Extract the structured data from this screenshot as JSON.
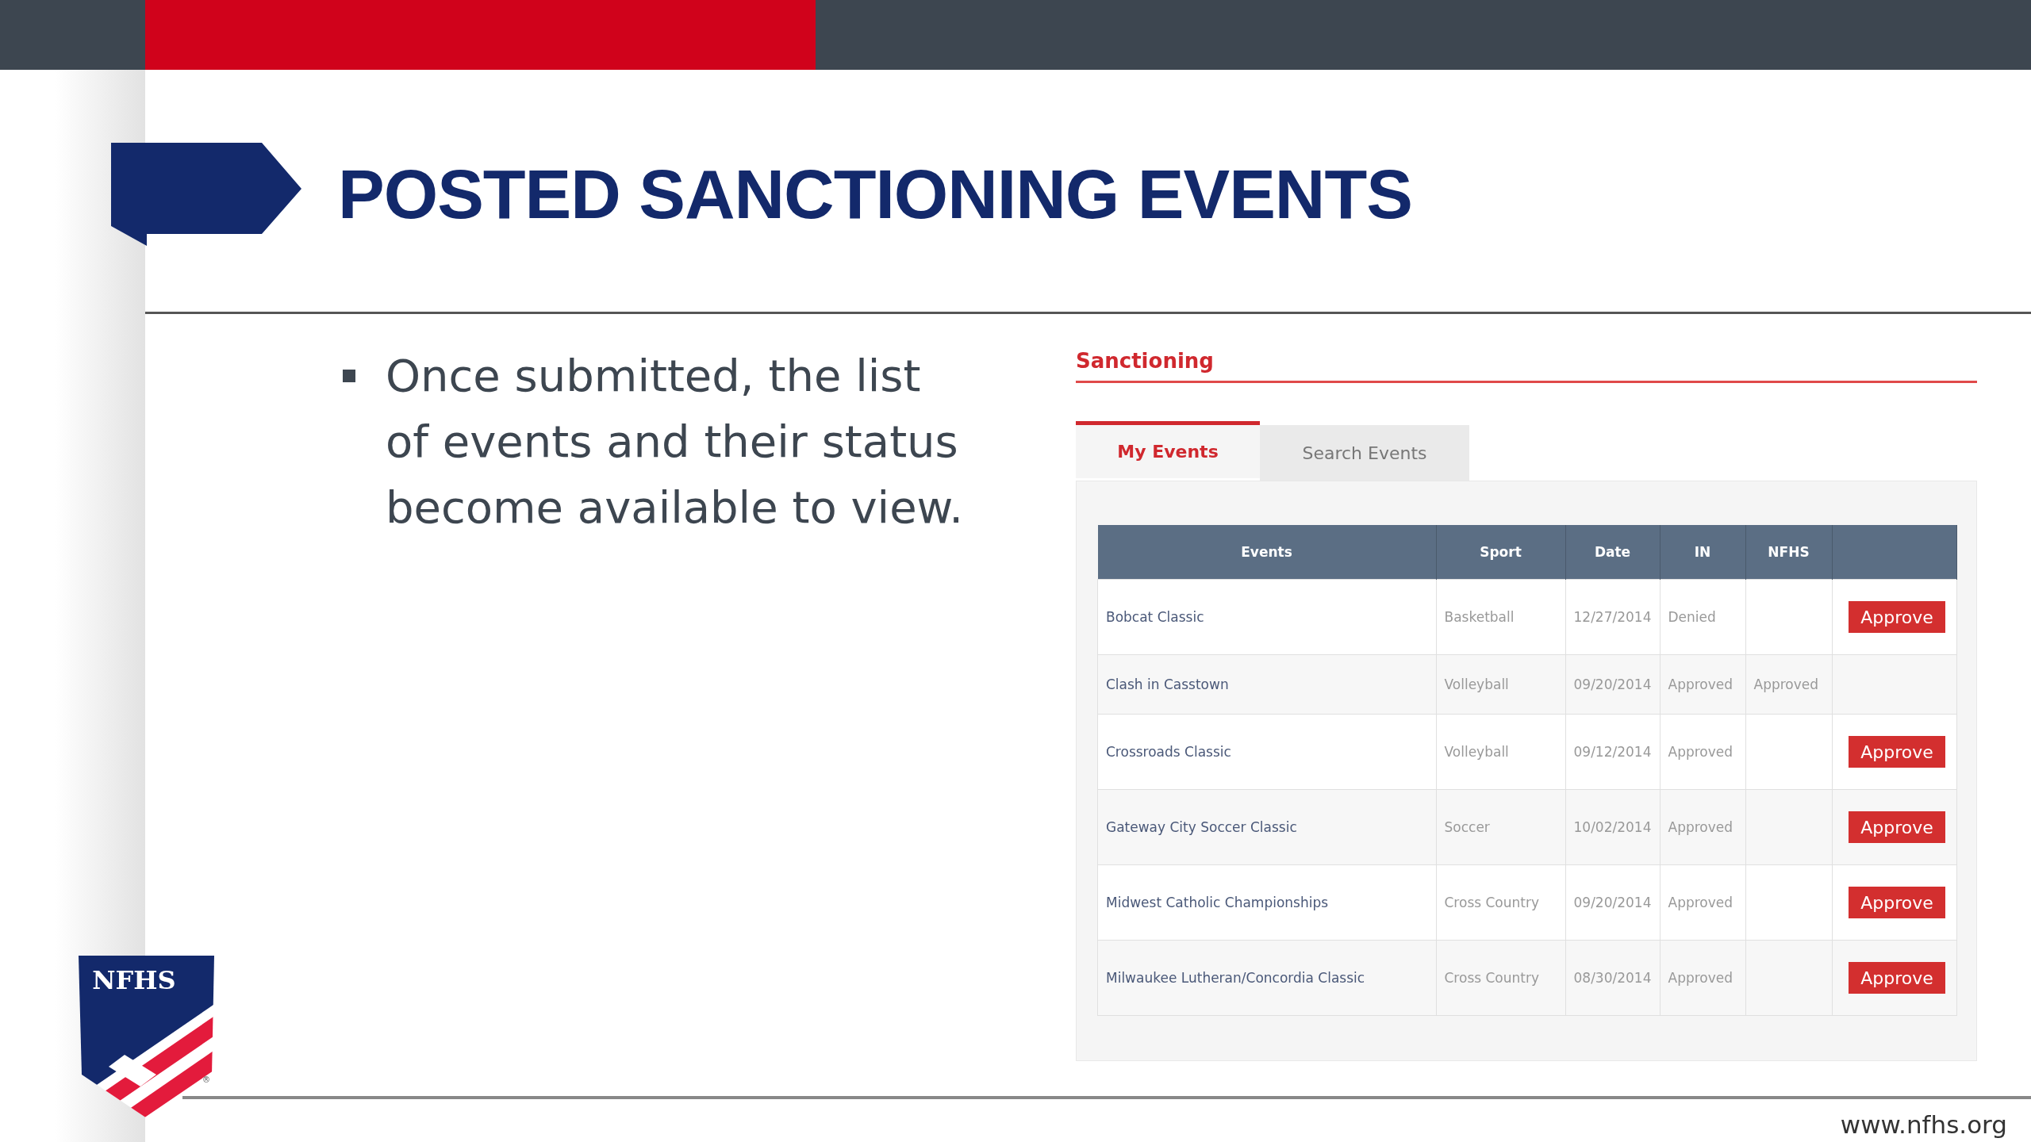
{
  "title": "POSTED SANCTIONING EVENTS",
  "bullets": [
    "Once submitted, the list of events and their status become available to view."
  ],
  "app": {
    "heading": "Sanctioning",
    "tabs": [
      {
        "label": "My Events",
        "selected": true
      },
      {
        "label": "Search Events",
        "selected": false
      }
    ],
    "table": {
      "columns": [
        "Events",
        "Sport",
        "Date",
        "IN",
        "NFHS"
      ],
      "rows": [
        {
          "event": "Bobcat Classic",
          "sport": "Basketball",
          "date": "12/27/2014",
          "in": "Denied",
          "action": "Approve"
        },
        {
          "event": "Clash in Casstown",
          "sport": "Volleyball",
          "date": "09/20/2014",
          "in": "Approved",
          "nfhs": "Approved"
        },
        {
          "event": "Crossroads Classic",
          "sport": "Volleyball",
          "date": "09/12/2014",
          "in": "Approved",
          "action": "Approve"
        },
        {
          "event": "Gateway City Soccer Classic",
          "sport": "Soccer",
          "date": "10/02/2014",
          "in": "Approved",
          "action": "Approve"
        },
        {
          "event": "Midwest Catholic Championships",
          "sport": "Cross Country",
          "date": "09/20/2014",
          "in": "Approved",
          "action": "Approve"
        },
        {
          "event": "Milwaukee Lutheran/Concordia Classic",
          "sport": "Cross Country",
          "date": "08/30/2014",
          "in": "Approved",
          "action": "Approve"
        }
      ]
    }
  },
  "logo": {
    "text": "NFHS",
    "mark": "®"
  },
  "footer": "www.nfhs.org"
}
